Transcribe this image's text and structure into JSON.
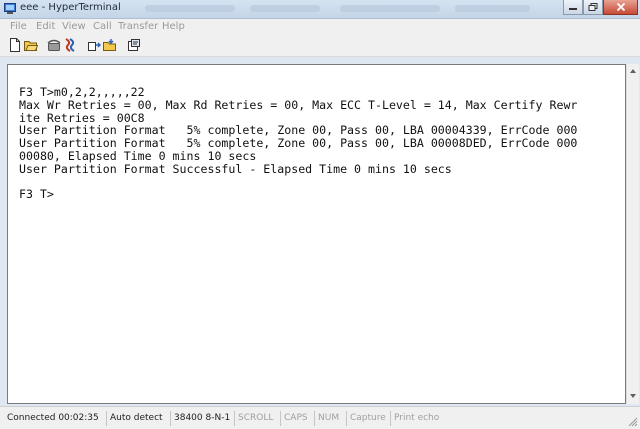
{
  "window": {
    "title": "eee - HyperTerminal"
  },
  "menu": [
    "File",
    "Edit",
    "View",
    "Call",
    "Transfer",
    "Help"
  ],
  "toolbar": {
    "icons": [
      "new-document-icon",
      "open-folder-icon",
      "phone-connect-icon",
      "disconnect-icon",
      "send-file-icon",
      "receive-file-icon",
      "properties-icon"
    ]
  },
  "terminal": {
    "lines": [
      "F3 T>m0,2,2,,,,,22",
      "Max Wr Retries = 00, Max Rd Retries = 00, Max ECC T-Level = 14, Max Certify Rewr",
      "ite Retries = 00C8",
      "User Partition Format   5% complete, Zone 00, Pass 00, LBA 00004339, ErrCode 000",
      "User Partition Format   5% complete, Zone 00, Pass 00, LBA 00008DED, ErrCode 000",
      "00080, Elapsed Time 0 mins 10 secs",
      "User Partition Format Successful - Elapsed Time 0 mins 10 secs",
      "",
      "F3 T>"
    ]
  },
  "status": {
    "connected": "Connected 00:02:35",
    "detect": "Auto detect",
    "settings": "38400 8-N-1",
    "scroll": "SCROLL",
    "caps": "CAPS",
    "num": "NUM",
    "capture": "Capture",
    "print_echo": "Print echo"
  }
}
